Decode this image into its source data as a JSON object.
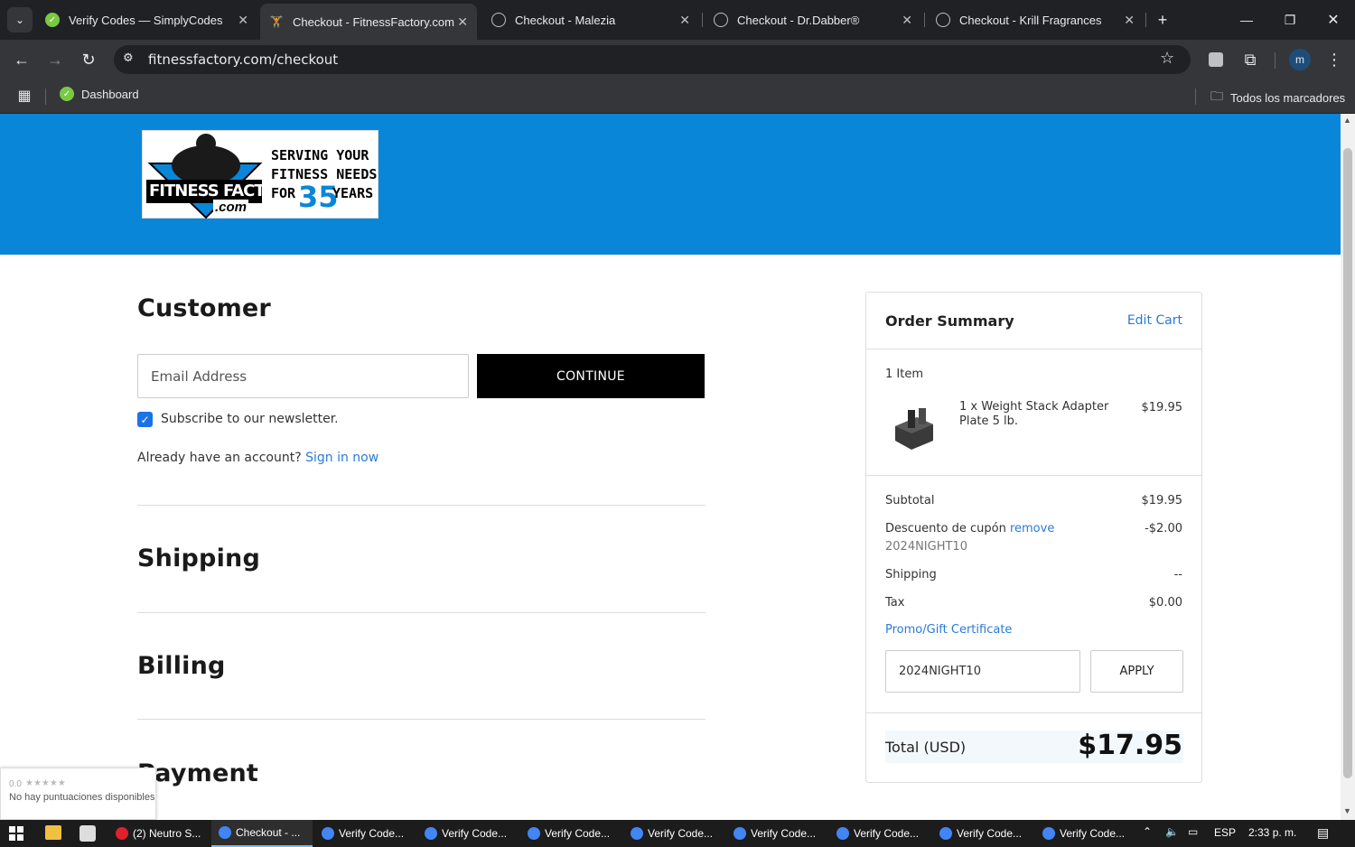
{
  "browser": {
    "tabs": [
      {
        "title": "Verify Codes — SimplyCodes",
        "active": false
      },
      {
        "title": "Checkout - FitnessFactory.com",
        "active": true
      },
      {
        "title": "Checkout - Malezia",
        "active": false
      },
      {
        "title": "Checkout - Dr.Dabber®",
        "active": false
      },
      {
        "title": "Checkout - Krill Fragrances",
        "active": false
      }
    ],
    "url": "fitnessfactory.com/checkout",
    "bookmarks": {
      "dashboard": "Dashboard",
      "all_bookmarks": "Todos los marcadores"
    },
    "profile_initial": "m"
  },
  "logo": {
    "brand": "FITNESS FACTORY",
    "brand_suffix": ".com",
    "tagline_1": "SERVING YOUR",
    "tagline_2": "FITNESS NEEDS",
    "tagline_3_prefix": "FOR",
    "tagline_3_number": "35",
    "tagline_3_suffix": "YEARS"
  },
  "customer": {
    "heading": "Customer",
    "email_placeholder": "Email Address",
    "continue_label": "CONTINUE",
    "newsletter_label": "Subscribe to our newsletter.",
    "newsletter_checked": true,
    "account_prompt": "Already have an account?",
    "sign_in_label": "Sign in now"
  },
  "sections": {
    "shipping": "Shipping",
    "billing": "Billing",
    "payment": "Payment"
  },
  "summary": {
    "title": "Order Summary",
    "edit_cart": "Edit Cart",
    "item_count": "1 Item",
    "item": {
      "quantity_name": "1 x Weight Stack Adapter Plate 5 lb.",
      "price": "$19.95"
    },
    "subtotal_label": "Subtotal",
    "subtotal_value": "$19.95",
    "discount_label": "Descuento de cupón",
    "discount_remove": "remove",
    "discount_code": "2024NIGHT10",
    "discount_value": "-$2.00",
    "shipping_label": "Shipping",
    "shipping_value": "--",
    "tax_label": "Tax",
    "tax_value": "$0.00",
    "promo_label": "Promo/Gift Certificate",
    "promo_input_value": "2024NIGHT10",
    "apply_label": "APPLY",
    "total_label": "Total (USD)",
    "total_value": "$17.95"
  },
  "rating_widget": {
    "score": "0.0",
    "text": "No hay puntuaciones disponibles"
  },
  "taskbar": {
    "items": [
      "(2) Neutro S...",
      "Checkout - ...",
      "Verify Code...",
      "Verify Code...",
      "Verify Code...",
      "Verify Code...",
      "Verify Code...",
      "Verify Code...",
      "Verify Code...",
      "Verify Code..."
    ],
    "language": "ESP",
    "time": "2:33 p. m."
  },
  "colors": {
    "header_blue": "#0a86d8",
    "link_blue": "#2a7bd6",
    "checkbox_blue": "#1a73e8"
  }
}
